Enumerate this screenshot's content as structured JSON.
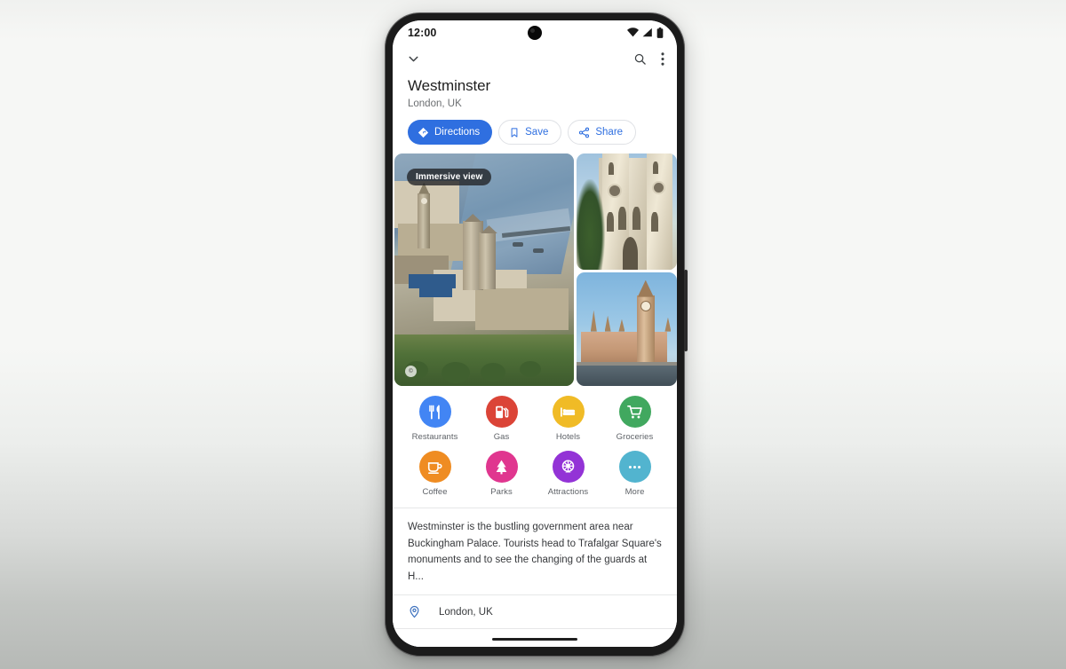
{
  "background": {
    "top_color": "#f6f7f5",
    "bottom_color": "#b6b9b6"
  },
  "device": {
    "name": "pixel-phone",
    "frame_color": "#1b1b1b"
  },
  "status_bar": {
    "time": "12:00",
    "icons": [
      "wifi-icon",
      "cellular-signal-icon",
      "battery-icon"
    ]
  },
  "app_bar": {
    "collapse_icon": "chevron-down-icon",
    "search_icon": "search-icon",
    "overflow_icon": "more-vertical-icon"
  },
  "place": {
    "title": "Westminster",
    "subtitle": "London, UK"
  },
  "actions": [
    {
      "label": "Directions",
      "icon": "directions-icon",
      "style": "primary",
      "color": "#2f6fe0"
    },
    {
      "label": "Save",
      "icon": "bookmark-icon",
      "style": "outline",
      "color": "#2f6fe0"
    },
    {
      "label": "Share",
      "icon": "share-icon",
      "style": "outline",
      "color": "#2f6fe0"
    }
  ],
  "photos": {
    "immersive_badge": "Immersive view",
    "main": {
      "name": "aerial-westminster-photo",
      "alt": "Aerial view of the Palace of Westminster and the River Thames"
    },
    "secondary": [
      {
        "name": "westminster-abbey-photo",
        "alt": "Westminster Abbey facade"
      },
      {
        "name": "big-ben-photo",
        "alt": "Big Ben and Houses of Parliament"
      }
    ]
  },
  "categories": [
    {
      "label": "Restaurants",
      "icon": "restaurant-icon",
      "color": "#4285f4"
    },
    {
      "label": "Gas",
      "icon": "gas-pump-icon",
      "color": "#db4437"
    },
    {
      "label": "Hotels",
      "icon": "hotel-bed-icon",
      "color": "#f0bb26"
    },
    {
      "label": "Groceries",
      "icon": "shopping-cart-icon",
      "color": "#41a85f"
    },
    {
      "label": "Coffee",
      "icon": "coffee-cup-icon",
      "color": "#ef8c22"
    },
    {
      "label": "Parks",
      "icon": "tree-icon",
      "color": "#e0368f"
    },
    {
      "label": "Attractions",
      "icon": "ferris-wheel-icon",
      "color": "#9333d6"
    },
    {
      "label": "More",
      "icon": "more-dots-icon",
      "color": "#52b4cf"
    }
  ],
  "description": "Westminster is the bustling government area near Buckingham Palace. Tourists head to Trafalgar Square's monuments and to see the changing of the guards at H...",
  "info_rows": [
    {
      "icon": "location-pin-icon",
      "text": "London, UK"
    },
    {
      "icon": "clock-icon",
      "text": ""
    }
  ],
  "gesture_bar": "home-gesture-bar"
}
